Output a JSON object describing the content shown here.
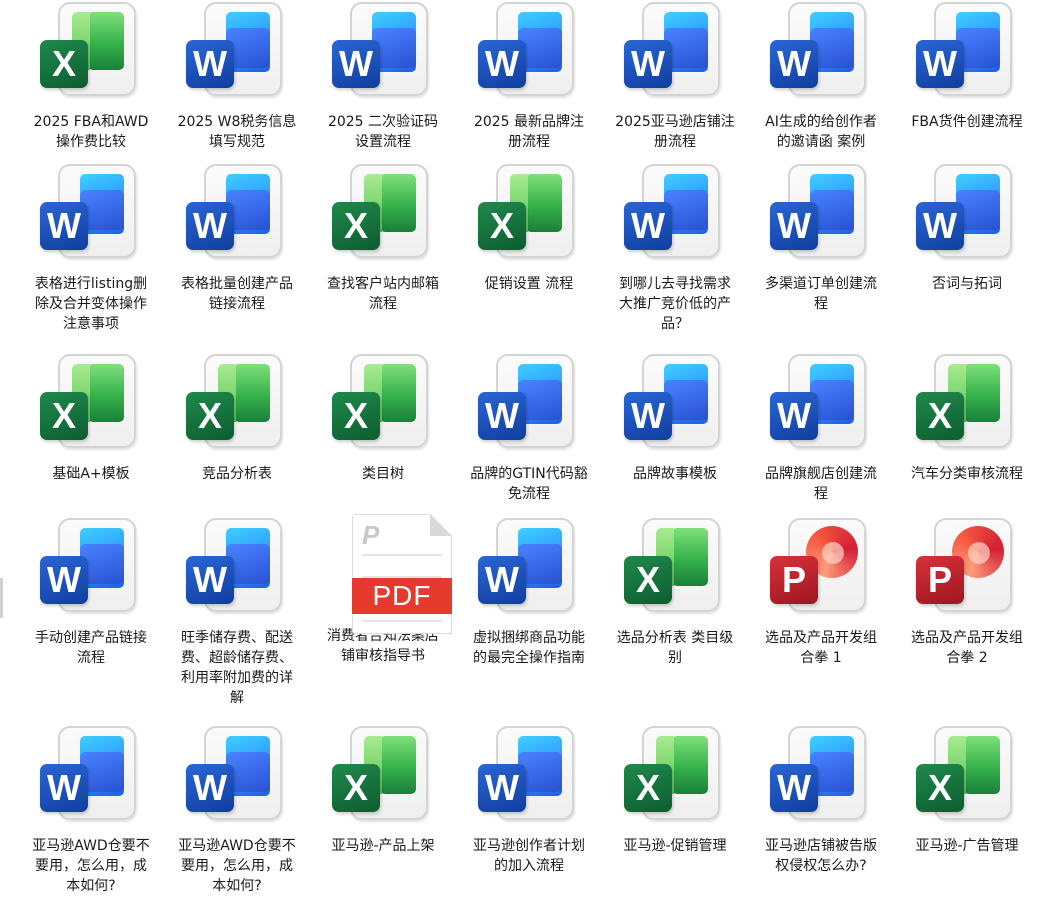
{
  "files": [
    {
      "name": "2025 FBA和AWD操作费比较",
      "type": "excel",
      "badge": "X"
    },
    {
      "name": "2025 W8税务信息填写规范",
      "type": "word",
      "badge": "W"
    },
    {
      "name": "2025 二次验证码设置流程",
      "type": "word",
      "badge": "W"
    },
    {
      "name": "2025 最新品牌注册流程",
      "type": "word",
      "badge": "W"
    },
    {
      "name": "2025亚马逊店铺注册流程",
      "type": "word",
      "badge": "W"
    },
    {
      "name": "AI生成的给创作者的邀请函 案例",
      "type": "word",
      "badge": "W"
    },
    {
      "name": "FBA货件创建流程",
      "type": "word",
      "badge": "W"
    },
    {
      "name": "表格进行listing删除及合并变体操作注意事项",
      "type": "word",
      "badge": "W"
    },
    {
      "name": "表格批量创建产品链接流程",
      "type": "word",
      "badge": "W"
    },
    {
      "name": "查找客户站内邮箱 流程",
      "type": "excel",
      "badge": "X"
    },
    {
      "name": "促销设置 流程",
      "type": "excel",
      "badge": "X"
    },
    {
      "name": "到哪儿去寻找需求大推广竞价低的产品？",
      "type": "word",
      "badge": "W"
    },
    {
      "name": "多渠道订单创建流程",
      "type": "word",
      "badge": "W"
    },
    {
      "name": "否词与拓词",
      "type": "word",
      "badge": "W"
    },
    {
      "name": "基础A+模板",
      "type": "excel",
      "badge": "X"
    },
    {
      "name": "竞品分析表",
      "type": "excel",
      "badge": "X"
    },
    {
      "name": "类目树",
      "type": "excel",
      "badge": "X"
    },
    {
      "name": "品牌的GTIN代码豁免流程",
      "type": "word",
      "badge": "W"
    },
    {
      "name": "品牌故事模板",
      "type": "word",
      "badge": "W"
    },
    {
      "name": "品牌旗舰店创建流程",
      "type": "word",
      "badge": "W"
    },
    {
      "name": "汽车分类审核流程",
      "type": "excel",
      "badge": "X"
    },
    {
      "name": "手动创建产品链接流程",
      "type": "word",
      "badge": "W"
    },
    {
      "name": "旺季储存费、配送费、超龄储存费、利用率附加费的详解",
      "type": "word",
      "badge": "W"
    },
    {
      "name": "消费者告知法案店铺审核指导书",
      "type": "pdf",
      "badge": "PDF",
      "pletter": "P"
    },
    {
      "name": "虚拟捆绑商品功能的最完全操作指南",
      "type": "word",
      "badge": "W"
    },
    {
      "name": "选品分析表 类目级别",
      "type": "excel",
      "badge": "X"
    },
    {
      "name": "选品及产品开发组合拳 1",
      "type": "ppt",
      "badge": "P"
    },
    {
      "name": "选品及产品开发组合拳 2",
      "type": "ppt",
      "badge": "P"
    },
    {
      "name": "亚马逊AWD仓要不要用，怎么用，成本如何?",
      "type": "word",
      "badge": "W"
    },
    {
      "name": "亚马逊AWD仓要不要用，怎么用，成本如何?",
      "type": "word",
      "badge": "W"
    },
    {
      "name": "亚马逊-产品上架",
      "type": "excel",
      "badge": "X"
    },
    {
      "name": "亚马逊创作者计划的加入流程",
      "type": "word",
      "badge": "W"
    },
    {
      "name": "亚马逊-促销管理",
      "type": "excel",
      "badge": "X"
    },
    {
      "name": "亚马逊店铺被告版权侵权怎么办?",
      "type": "word",
      "badge": "W"
    },
    {
      "name": "亚马逊-广告管理",
      "type": "excel",
      "badge": "X"
    }
  ]
}
